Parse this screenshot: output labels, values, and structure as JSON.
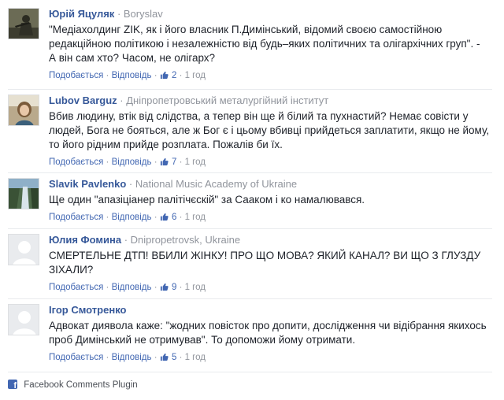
{
  "comments": [
    {
      "author": "Юрій Яцуляк",
      "meta": "Boryslav",
      "text": "\"Медіахолдинг ZIK, як і його власник П.Димінський, відомий своєю самостійною редакційною політикою і незалежністю від будь–яких політичних та олігархічних груп\". - А він сам хто? Часом, не олігарх?",
      "like": "Подобається",
      "reply": "Відповідь",
      "likes": "2",
      "time": "1 год"
    },
    {
      "author": "Lubov Barguz",
      "meta": "Дніпропетровський металургійний інститут",
      "text": "Вбив людину, втік від слідства, а тепер він ще й білий та пухнастий? Немає совісти у людей, Бога не бояться, але ж Бог є і цьому вбивці прийдеться заплатити, якщо не йому, то його рідним прийде розплата. Пожалів би їх.",
      "like": "Подобається",
      "reply": "Відповідь",
      "likes": "7",
      "time": "1 год"
    },
    {
      "author": "Slavik Pavlenko",
      "meta": "National Music Academy of Ukraine",
      "text": "Ще один \"апазіціанер палітічєскій\" за Сааком і ко намалювався.",
      "like": "Подобається",
      "reply": "Відповідь",
      "likes": "6",
      "time": "1 год"
    },
    {
      "author": "Юлия Фомина",
      "meta": "Dnipropetrovsk, Ukraine",
      "text": "СМЕРТЕЛЬНЕ ДТП! ВБИЛИ ЖІНКУ! ПРО ЩО МОВА? ЯКИЙ КАНАЛ? ВИ ЩО З ГЛУЗДУ ЗІХАЛИ?",
      "like": "Подобається",
      "reply": "Відповідь",
      "likes": "9",
      "time": "1 год"
    },
    {
      "author": "Ігор Смотренко",
      "meta": "",
      "text": "Адвокат диявола каже: \"жодних повісток про допити, дослідження чи відібрання якихось проб Димінський не отримував\". То допоможи йому отримати.",
      "like": "Подобається",
      "reply": "Відповідь",
      "likes": "5",
      "time": "1 год"
    }
  ],
  "footer": {
    "label": "Facebook Comments Plugin",
    "icon": "facebook-icon"
  },
  "colors": {
    "author": "#365899",
    "link": "#4267b2",
    "meta": "#90949c",
    "separator": "#e9ebee"
  }
}
